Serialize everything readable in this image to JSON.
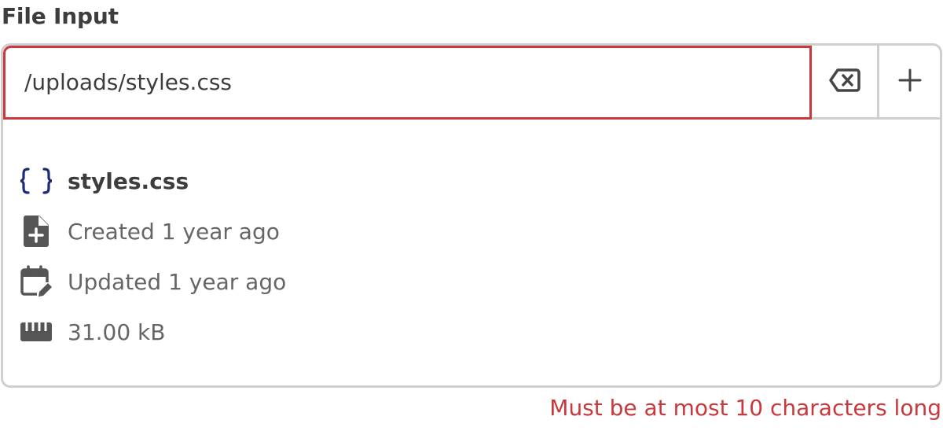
{
  "field": {
    "label": "File Input"
  },
  "input": {
    "value": "/uploads/styles.css"
  },
  "buttons": {
    "clear_icon": "backspace-x-icon",
    "add_icon": "plus-icon"
  },
  "file": {
    "type_icon": "curly-braces-icon",
    "name": "styles.css",
    "created_icon": "file-plus-icon",
    "created": "Created 1 year ago",
    "updated_icon": "calendar-edit-icon",
    "updated": "Updated 1 year ago",
    "size_icon": "ruler-icon",
    "size": "31.00 kB"
  },
  "validation": {
    "error": "Must be at most 10 characters long"
  },
  "colors": {
    "error": "#c9383a",
    "border": "#cfcfcf",
    "file_type_icon": "#1c2a78",
    "text": "#3d3d3d",
    "muted": "#666666"
  }
}
